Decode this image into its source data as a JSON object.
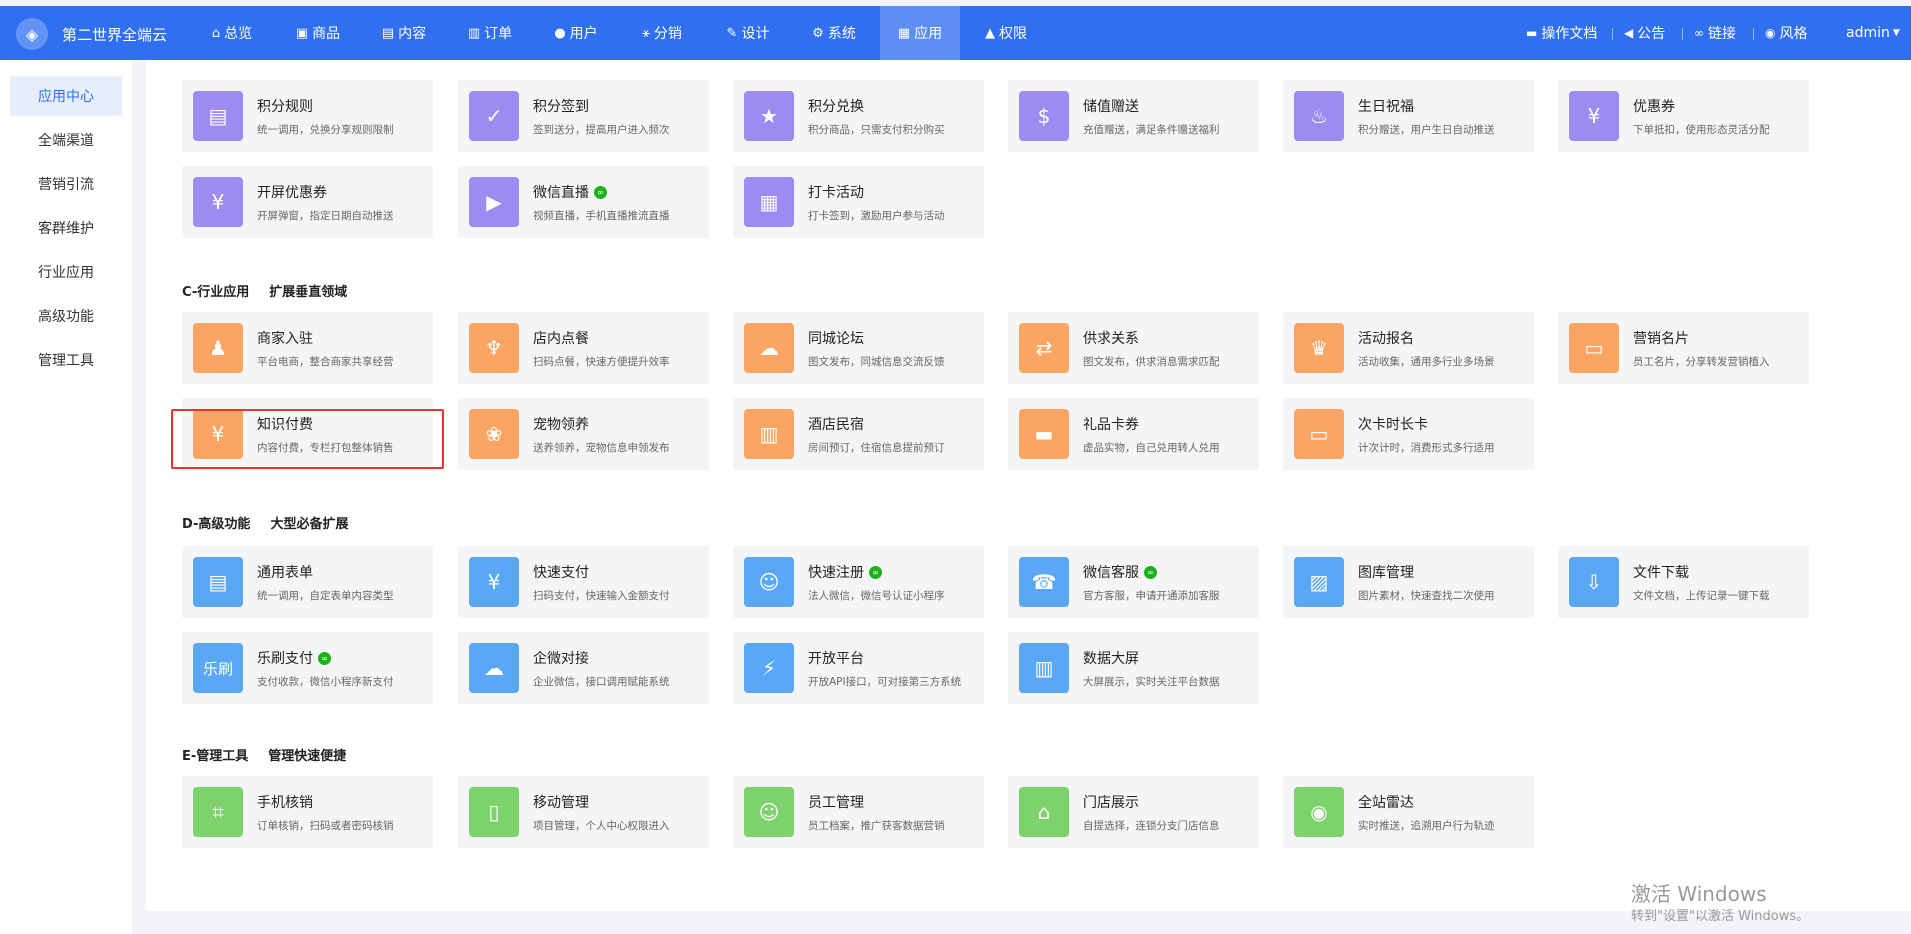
{
  "app": {
    "brand": "第二世界全端云"
  },
  "topnav": [
    {
      "label": "总览",
      "icon": "home-icon",
      "glyph": "⌂"
    },
    {
      "label": "商品",
      "icon": "goods-icon",
      "glyph": "▣"
    },
    {
      "label": "内容",
      "icon": "content-icon",
      "glyph": "▤"
    },
    {
      "label": "订单",
      "icon": "order-icon",
      "glyph": "▥"
    },
    {
      "label": "用户",
      "icon": "user-icon",
      "glyph": "●"
    },
    {
      "label": "分销",
      "icon": "distribution-icon",
      "glyph": "⚹"
    },
    {
      "label": "设计",
      "icon": "design-icon",
      "glyph": "✎"
    },
    {
      "label": "系统",
      "icon": "gear-icon",
      "glyph": "⚙"
    },
    {
      "label": "应用",
      "icon": "apps-icon",
      "glyph": "▦"
    },
    {
      "label": "权限",
      "icon": "lock-icon",
      "glyph": "▲"
    }
  ],
  "rightnav": {
    "docs": "操作文档",
    "notice": "公告",
    "link": "链接",
    "style": "风格",
    "user": "admin"
  },
  "sidebar": [
    {
      "label": "应用中心"
    },
    {
      "label": "全端渠道"
    },
    {
      "label": "营销引流"
    },
    {
      "label": "客群维护"
    },
    {
      "label": "行业应用"
    },
    {
      "label": "高级功能"
    },
    {
      "label": "管理工具"
    }
  ],
  "sections": [
    {
      "key": "c",
      "code": "C-行业应用",
      "sub": "扩展垂直领域"
    },
    {
      "key": "d",
      "code": "D-高级功能",
      "sub": "大型必备扩展"
    },
    {
      "key": "e",
      "code": "E-管理工具",
      "sub": "管理快速便捷"
    }
  ],
  "cards": [
    {
      "name": "积分规则",
      "desc": "统一调用，兑换分享规则限制",
      "color": "#9a8cf0",
      "icon": "points-rule-icon",
      "glyph": "▤",
      "badge": false
    },
    {
      "name": "积分签到",
      "desc": "签到送分，提高用户进入频次",
      "color": "#9a8cf0",
      "icon": "calendar-check-icon",
      "glyph": "✓",
      "badge": false
    },
    {
      "name": "积分兑换",
      "desc": "积分商品，只需支付积分购买",
      "color": "#9a8cf0",
      "icon": "star-icon",
      "glyph": "★",
      "badge": false
    },
    {
      "name": "储值赠送",
      "desc": "充值赠送，满足条件赠送福利",
      "color": "#9a8cf0",
      "icon": "money-bag-icon",
      "glyph": "$",
      "badge": false
    },
    {
      "name": "生日祝福",
      "desc": "积分赠送，用户生日自动推送",
      "color": "#9a8cf0",
      "icon": "cake-icon",
      "glyph": "♨",
      "badge": false
    },
    {
      "name": "优惠券",
      "desc": "下单抵扣，使用形态灵活分配",
      "color": "#9a8cf0",
      "icon": "coupon-icon",
      "glyph": "¥",
      "badge": false
    },
    {
      "name": "开屏优惠券",
      "desc": "开屏弹窗，指定日期自动推送",
      "color": "#9a8cf0",
      "icon": "ticket-icon",
      "glyph": "¥",
      "badge": false
    },
    {
      "name": "微信直播",
      "desc": "视频直播，手机直播推流直播",
      "color": "#9a8cf0",
      "icon": "video-icon",
      "glyph": "▶",
      "badge": true
    },
    {
      "name": "打卡活动",
      "desc": "打卡签到，激励用户参与活动",
      "color": "#9a8cf0",
      "icon": "calendar-icon",
      "glyph": "▦",
      "badge": false
    },
    {
      "name": "商家入驻",
      "desc": "平台电商，整合商家共享经营",
      "color": "#fba564",
      "icon": "merchant-icon",
      "glyph": "♟",
      "badge": false
    },
    {
      "name": "店内点餐",
      "desc": "扫码点餐，快速方便提升效率",
      "color": "#fba564",
      "icon": "fork-knife-icon",
      "glyph": "♆",
      "badge": false
    },
    {
      "name": "同城论坛",
      "desc": "图文发布，同城信息交流反馈",
      "color": "#fba564",
      "icon": "chat-icon",
      "glyph": "☁",
      "badge": false
    },
    {
      "name": "供求关系",
      "desc": "图文发布，供求消息需求匹配",
      "color": "#fba564",
      "icon": "exchange-icon",
      "glyph": "⇄",
      "badge": false
    },
    {
      "name": "活动报名",
      "desc": "活动收集，通用多行业多场景",
      "color": "#fba564",
      "icon": "trophy-icon",
      "glyph": "♛",
      "badge": false
    },
    {
      "name": "营销名片",
      "desc": "员工名片，分享转发营销植入",
      "color": "#fba564",
      "icon": "card-icon",
      "glyph": "▭",
      "badge": false
    },
    {
      "name": "知识付费",
      "desc": "内容付费，专栏打包整体销售",
      "color": "#fba564",
      "icon": "knowledge-icon",
      "glyph": "¥",
      "badge": false
    },
    {
      "name": "宠物领养",
      "desc": "送养领养，宠物信息申领发布",
      "color": "#fba564",
      "icon": "paw-icon",
      "glyph": "❀",
      "badge": false
    },
    {
      "name": "酒店民宿",
      "desc": "房间预订，住宿信息提前预订",
      "color": "#fba564",
      "icon": "hotel-icon",
      "glyph": "▥",
      "badge": false
    },
    {
      "name": "礼品卡券",
      "desc": "虚品实物，自己兑用转人兑用",
      "color": "#fba564",
      "icon": "gift-card-icon",
      "glyph": "▬",
      "badge": false
    },
    {
      "name": "次卡时长卡",
      "desc": "计次计时，消费形式多行适用",
      "color": "#fba564",
      "icon": "time-card-icon",
      "glyph": "▭",
      "badge": false
    },
    {
      "name": "通用表单",
      "desc": "统一调用，自定表单内容类型",
      "color": "#5aa7f5",
      "icon": "form-icon",
      "glyph": "▤",
      "badge": false
    },
    {
      "name": "快速支付",
      "desc": "扫码支付，快速输入金额支付",
      "color": "#5aa7f5",
      "icon": "shield-pay-icon",
      "glyph": "¥",
      "badge": false
    },
    {
      "name": "快速注册",
      "desc": "法人微信，微信号认证小程序",
      "color": "#5aa7f5",
      "icon": "user-add-icon",
      "glyph": "☺",
      "badge": true
    },
    {
      "name": "微信客服",
      "desc": "官方客服，申请开通添加客服",
      "color": "#5aa7f5",
      "icon": "headset-icon",
      "glyph": "☎",
      "badge": true
    },
    {
      "name": "图库管理",
      "desc": "图片素材，快速查找二次使用",
      "color": "#5aa7f5",
      "icon": "gallery-icon",
      "glyph": "▨",
      "badge": false
    },
    {
      "name": "文件下载",
      "desc": "文件文档，上传记录一键下载",
      "color": "#5aa7f5",
      "icon": "download-icon",
      "glyph": "⇩",
      "badge": false
    },
    {
      "name": "乐刷支付",
      "desc": "支付收款，微信小程序新支付",
      "color": "#5aa7f5",
      "icon": "leshua-icon",
      "glyph": "乐刷",
      "badge": true
    },
    {
      "name": "企微对接",
      "desc": "企业微信，接口调用赋能系统",
      "color": "#5aa7f5",
      "icon": "wecom-icon",
      "glyph": "☁",
      "badge": false
    },
    {
      "name": "开放平台",
      "desc": "开放API接口，可对接第三方系统",
      "color": "#5aa7f5",
      "icon": "plug-icon",
      "glyph": "⚡",
      "badge": false
    },
    {
      "name": "数据大屏",
      "desc": "大屏展示，实时关注平台数据",
      "color": "#5aa7f5",
      "icon": "dashboard-icon",
      "glyph": "▥",
      "badge": false
    },
    {
      "name": "手机核销",
      "desc": "订单核销，扫码或者密码核销",
      "color": "#7ed26b",
      "icon": "scan-icon",
      "glyph": "⌗",
      "badge": false
    },
    {
      "name": "移动管理",
      "desc": "项目管理，个人中心权限进入",
      "color": "#7ed26b",
      "icon": "mobile-icon",
      "glyph": "▯",
      "badge": false
    },
    {
      "name": "员工管理",
      "desc": "员工档案，推广获客数据营销",
      "color": "#7ed26b",
      "icon": "staff-icon",
      "glyph": "☺",
      "badge": false
    },
    {
      "name": "门店展示",
      "desc": "自提选择，连锁分支门店信息",
      "color": "#7ed26b",
      "icon": "store-icon",
      "glyph": "⌂",
      "badge": false
    },
    {
      "name": "全站雷达",
      "desc": "实时推送，追溯用户行为轨迹",
      "color": "#7ed26b",
      "icon": "radar-icon",
      "glyph": "◉",
      "badge": false
    }
  ],
  "watermark": {
    "line1": "激活 Windows",
    "line2": "转到\"设置\"以激活 Windows。"
  }
}
